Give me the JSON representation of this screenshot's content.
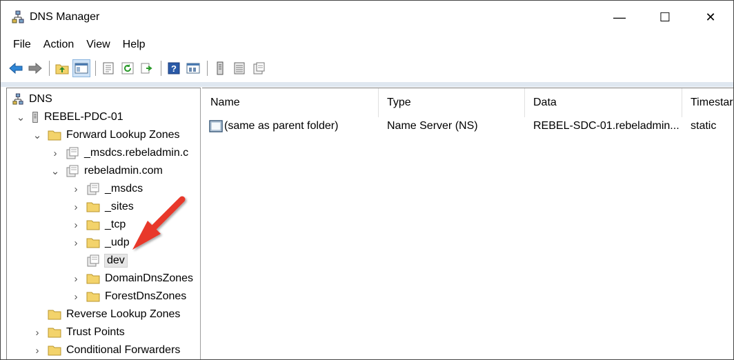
{
  "window": {
    "title": "DNS Manager",
    "minimize": "—",
    "maximize": "☐",
    "close": "✕"
  },
  "menu": [
    "File",
    "Action",
    "View",
    "Help"
  ],
  "toolbar_icons": [
    "back-arrow-icon",
    "forward-arrow-icon",
    "up-folder-icon",
    "console-tree-icon",
    "properties-icon",
    "refresh-icon",
    "export-list-icon",
    "help-icon",
    "details-view-icon",
    "server-icon",
    "zone-list-icon",
    "zone-details-icon"
  ],
  "tree": {
    "root": "DNS",
    "server": "REBEL-PDC-01",
    "forward_zones": "Forward Lookup Zones",
    "msdcs_zone": "_msdcs.rebeladmin.c",
    "zone": "rebeladmin.com",
    "children": [
      "_msdcs",
      "_sites",
      "_tcp",
      "_udp",
      "dev",
      "DomainDnsZones",
      "ForestDnsZones"
    ],
    "reverse_zones": "Reverse Lookup Zones",
    "trust_points": "Trust Points",
    "conditional_forwarders": "Conditional Forwarders"
  },
  "list": {
    "columns": [
      "Name",
      "Type",
      "Data",
      "Timestar"
    ],
    "rows": [
      {
        "name": "(same as parent folder)",
        "type": "Name Server (NS)",
        "data": "REBEL-SDC-01.rebeladmin...",
        "timestamp": "static"
      }
    ]
  },
  "colors": {
    "accent_arrow": "#e8392b",
    "folder": "#f3d36b",
    "selection": "#e6e6e6"
  }
}
